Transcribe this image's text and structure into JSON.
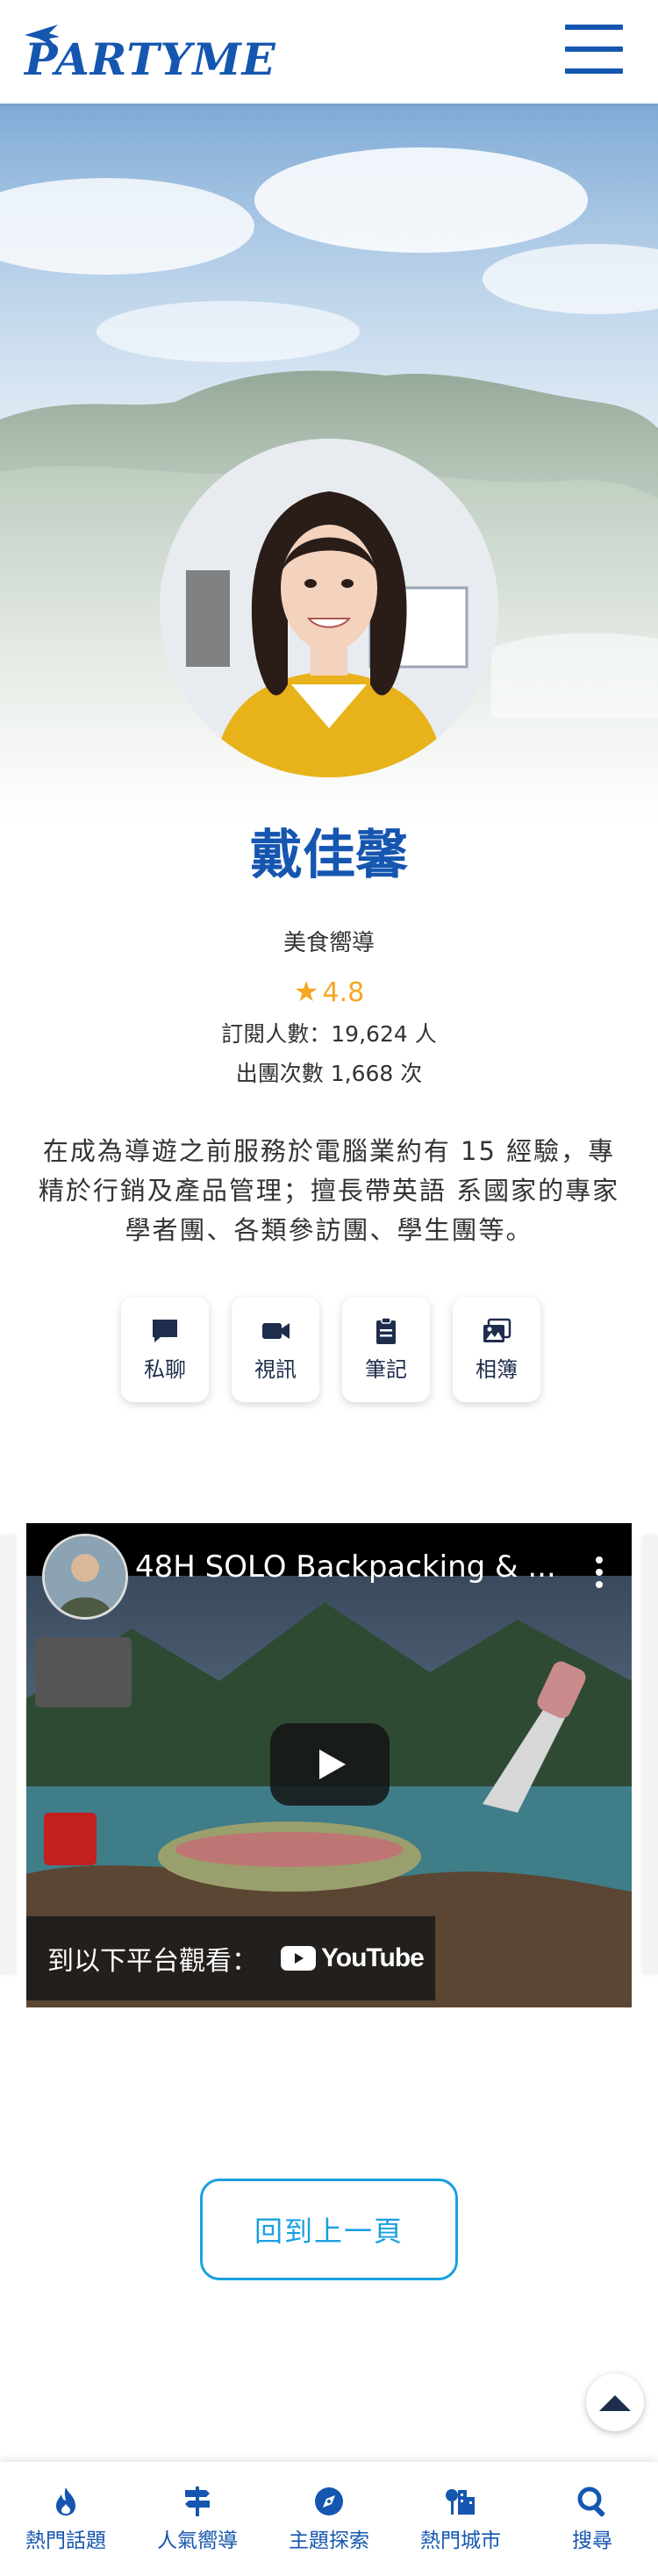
{
  "header": {
    "logo_text": "PARTYME",
    "menu_icon": "hamburger-menu-icon"
  },
  "profile": {
    "name": "戴佳馨",
    "role": "美食嚮導",
    "rating": "4.8",
    "subscribers": "訂閱人數：19,624 人",
    "tours": "出團次數 1,668 次",
    "bio": "在成為導遊之前服務於電腦業約有 15 經驗，專精於行銷及產品管理；擅長帶英語 系國家的專家學者團、各類參訪團、學生團等。"
  },
  "actions": [
    {
      "label": "私聊",
      "icon": "chat-icon"
    },
    {
      "label": "視訊",
      "icon": "video-camera-icon"
    },
    {
      "label": "筆記",
      "icon": "clipboard-icon"
    },
    {
      "label": "相簿",
      "icon": "photo-album-icon"
    }
  ],
  "video": {
    "title": "48H SOLO Backpacking & ...",
    "watch_on": "到以下平台觀看：",
    "platform": "YouTube"
  },
  "back_label": "回到上一頁",
  "bottom_nav": [
    {
      "label": "熱門話題",
      "icon": "flame-icon"
    },
    {
      "label": "人氣嚮導",
      "icon": "signpost-icon"
    },
    {
      "label": "主題探索",
      "icon": "compass-icon"
    },
    {
      "label": "熱門城市",
      "icon": "city-icon"
    },
    {
      "label": "搜尋",
      "icon": "search-icon"
    }
  ],
  "colors": {
    "brand": "#1556b0",
    "accent": "#1aa0e0",
    "star": "#f5a623"
  }
}
